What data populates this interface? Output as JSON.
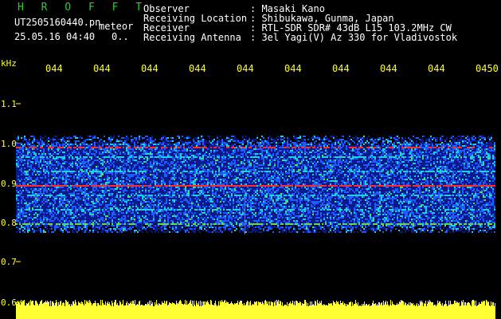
{
  "header": {
    "program": "H R O F F T",
    "filename": "UT2505160440.pn",
    "mode": "meteor",
    "datetime": "25.05.16 04:40",
    "extra": "0.."
  },
  "info": {
    "labels": [
      "Observer",
      "Receiving Location",
      "Receiver",
      "Receiving Antenna"
    ],
    "values": [
      ": Masaki Kano",
      ": Shibukawa, Gunma, Japan",
      ": RTL-SDR SDR# 43dB L15 103.2MHz CW",
      ": 3el Yagi(V) Az 330 for Vladivostok"
    ]
  },
  "yaxis": {
    "unit": "kHz",
    "ticks": [
      "1.1",
      "1.0",
      "0.9",
      "0.8",
      "0.7",
      "0.6"
    ]
  },
  "xaxis": {
    "ticks": [
      "044",
      "044",
      "044",
      "044",
      "044",
      "044",
      "044",
      "044",
      "044",
      "0450"
    ]
  },
  "colors": {
    "background": "#000000",
    "text": "#ffffff",
    "axis": "#ffff33",
    "title": "#33cc33",
    "noise_low": "#0a1a8a",
    "noise_mid": "#1e5cff",
    "noise_high": "#20d0e0",
    "signal": "#ff2a2a"
  }
}
